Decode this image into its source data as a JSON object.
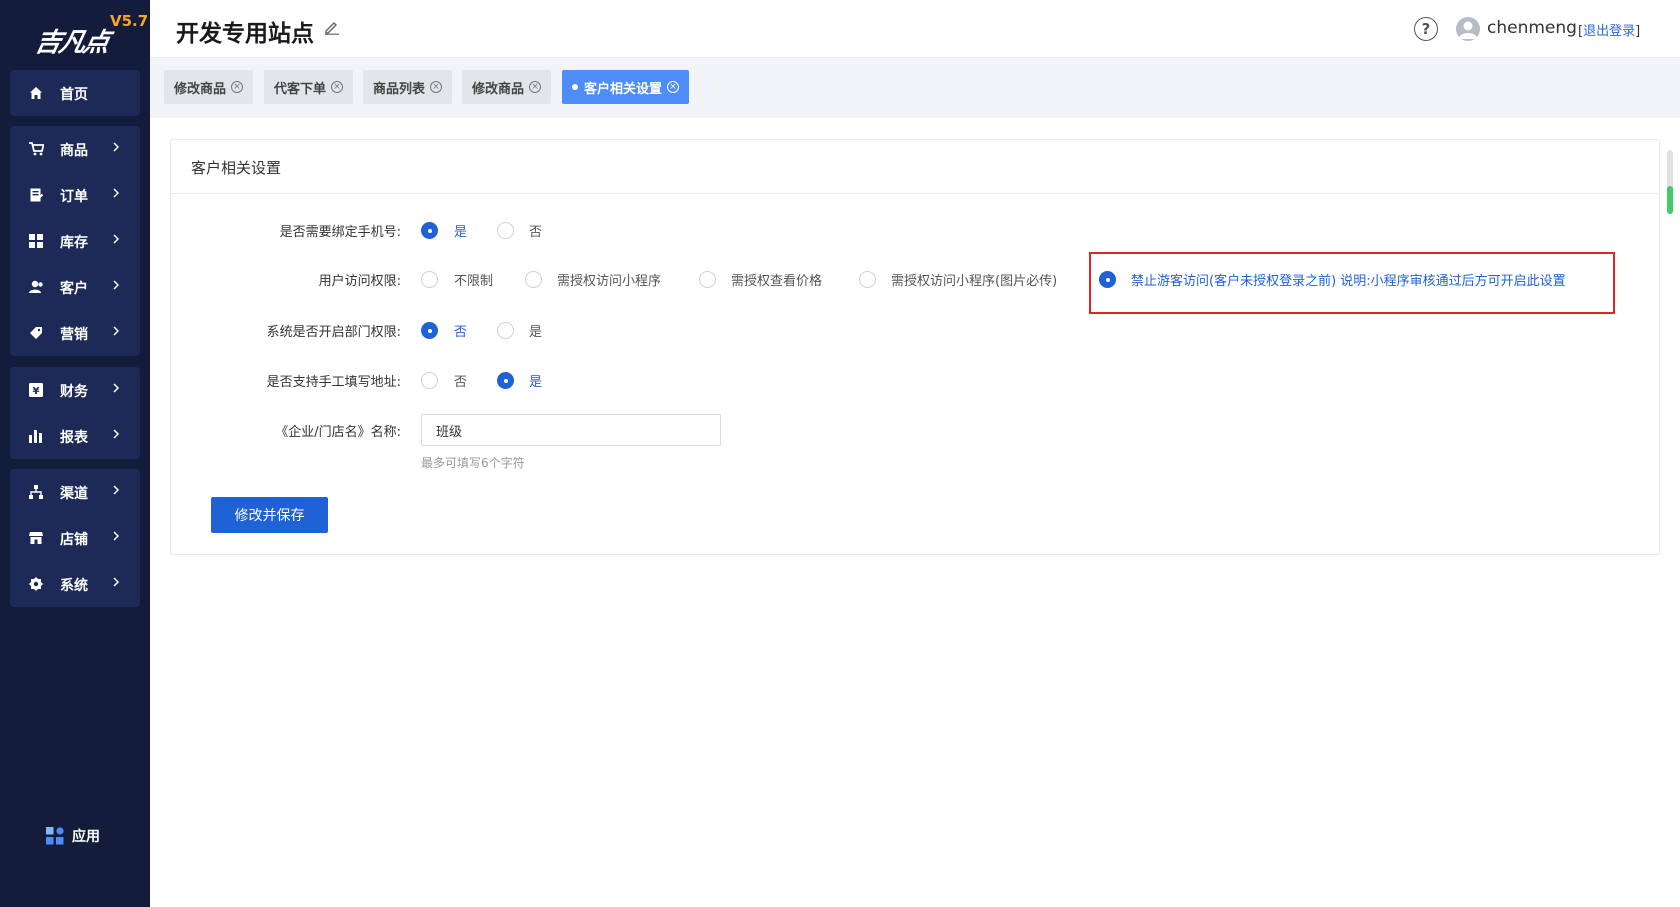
{
  "logo": {
    "text": "吉凡点",
    "version": "V5.7"
  },
  "sidebar": {
    "items": [
      {
        "label": "首页",
        "icon": "home-icon"
      },
      {
        "label": "商品",
        "icon": "cart-icon"
      },
      {
        "label": "订单",
        "icon": "order-icon"
      },
      {
        "label": "库存",
        "icon": "inventory-icon"
      },
      {
        "label": "客户",
        "icon": "customer-icon"
      },
      {
        "label": "营销",
        "icon": "tag-icon"
      },
      {
        "label": "财务",
        "icon": "finance-icon"
      },
      {
        "label": "报表",
        "icon": "chart-icon"
      },
      {
        "label": "渠道",
        "icon": "channel-icon"
      },
      {
        "label": "店铺",
        "icon": "store-icon"
      },
      {
        "label": "系统",
        "icon": "gear-icon"
      }
    ],
    "apps_label": "应用"
  },
  "header": {
    "site_title": "开发专用站点",
    "help": "?",
    "username": "chenmeng",
    "logout": "退出登录"
  },
  "tabs": [
    {
      "label": "修改商品"
    },
    {
      "label": "代客下单"
    },
    {
      "label": "商品列表"
    },
    {
      "label": "修改商品"
    },
    {
      "label": "客户相关设置",
      "active": true
    }
  ],
  "card": {
    "title": "客户相关设置",
    "rows": [
      {
        "label": "是否需要绑定手机号:",
        "options": [
          "是",
          "否"
        ],
        "selected": 0
      },
      {
        "label": "用户访问权限:",
        "options": [
          "不限制",
          "需授权访问小程序",
          "需授权查看价格",
          "需授权访问小程序(图片必传)",
          "禁止游客访问(客户未授权登录之前) 说明:小程序审核通过后方可开启此设置"
        ],
        "selected": 4
      },
      {
        "label": "系统是否开启部门权限:",
        "options": [
          "否",
          "是"
        ],
        "selected": 0
      },
      {
        "label": "是否支持手工填写地址:",
        "options": [
          "否",
          "是"
        ],
        "selected": 1
      }
    ],
    "name_field": {
      "label": "《企业/门店名》名称:",
      "value": "班级",
      "hint": "最多可填写6个字符"
    },
    "save_label": "修改并保存"
  },
  "colors": {
    "sidebar_bg": "#131c3a",
    "accent": "#1f62d6",
    "tab_active": "#4e8cf7",
    "highlight": "#e02424",
    "version": "#f5a623"
  }
}
